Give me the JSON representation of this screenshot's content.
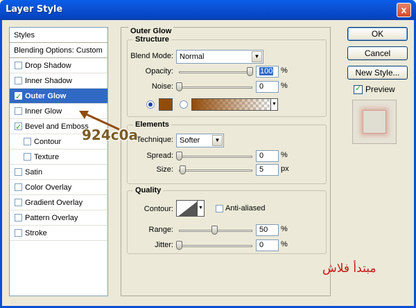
{
  "window": {
    "title": "Layer Style",
    "close_label": "x"
  },
  "styles_list": {
    "header": "Styles",
    "blending": "Blending Options: Custom",
    "items": [
      {
        "label": "Drop Shadow",
        "checked": false,
        "indent": false,
        "selected": false
      },
      {
        "label": "Inner Shadow",
        "checked": false,
        "indent": false,
        "selected": false
      },
      {
        "label": "Outer Glow",
        "checked": true,
        "indent": false,
        "selected": true
      },
      {
        "label": "Inner Glow",
        "checked": false,
        "indent": false,
        "selected": false
      },
      {
        "label": "Bevel and Emboss",
        "checked": true,
        "indent": false,
        "selected": false
      },
      {
        "label": "Contour",
        "checked": false,
        "indent": true,
        "selected": false
      },
      {
        "label": "Texture",
        "checked": false,
        "indent": true,
        "selected": false
      },
      {
        "label": "Satin",
        "checked": false,
        "indent": false,
        "selected": false
      },
      {
        "label": "Color Overlay",
        "checked": false,
        "indent": false,
        "selected": false
      },
      {
        "label": "Gradient Overlay",
        "checked": false,
        "indent": false,
        "selected": false
      },
      {
        "label": "Pattern Overlay",
        "checked": false,
        "indent": false,
        "selected": false
      },
      {
        "label": "Stroke",
        "checked": false,
        "indent": false,
        "selected": false
      }
    ]
  },
  "outer_glow": {
    "title": "Outer Glow",
    "structure": {
      "title": "Structure",
      "blend_mode_label": "Blend Mode:",
      "blend_mode_value": "Normal",
      "opacity_label": "Opacity:",
      "opacity_value": "100",
      "opacity_unit": "%",
      "noise_label": "Noise:",
      "noise_value": "0",
      "noise_unit": "%",
      "glow_color": "#924c0a"
    },
    "elements": {
      "title": "Elements",
      "technique_label": "Technique:",
      "technique_value": "Softer",
      "spread_label": "Spread:",
      "spread_value": "0",
      "spread_unit": "%",
      "size_label": "Size:",
      "size_value": "5",
      "size_unit": "px"
    },
    "quality": {
      "title": "Quality",
      "contour_label": "Contour:",
      "anti_aliased_label": "Anti-aliased",
      "range_label": "Range:",
      "range_value": "50",
      "range_unit": "%",
      "jitter_label": "Jitter:",
      "jitter_value": "0",
      "jitter_unit": "%"
    }
  },
  "buttons": {
    "ok": "OK",
    "cancel": "Cancel",
    "new_style": "New Style...",
    "preview_label": "Preview"
  },
  "annotations": {
    "hex_code": "924c0a",
    "arabic_text": "مبتدأ فلاش"
  }
}
